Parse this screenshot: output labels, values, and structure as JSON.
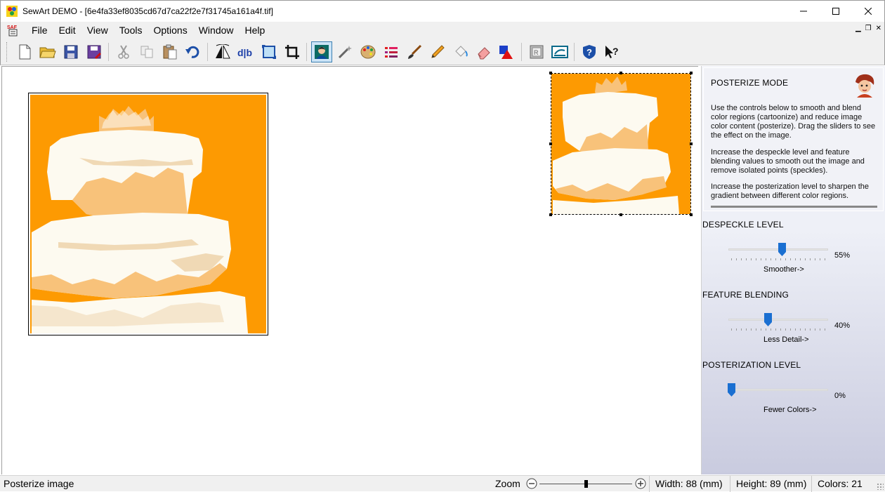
{
  "window": {
    "title": "SewArt DEMO - [6e4fa33ef8035cd67d7ca22f2e7f31745a161a4f.tif]"
  },
  "menu": {
    "items": [
      "File",
      "Edit",
      "View",
      "Tools",
      "Options",
      "Window",
      "Help"
    ]
  },
  "toolbar": {
    "icons": [
      "new-icon",
      "open-icon",
      "save-icon",
      "save-as-icon",
      "cut-icon",
      "copy-icon",
      "paste-icon",
      "undo-icon",
      "flip-icon",
      "mirror-icon",
      "resize-icon",
      "crop-icon",
      "posterize-icon",
      "magic-wand-icon",
      "palette-icon",
      "color-list-icon",
      "brush-icon",
      "pencil-icon",
      "fill-icon",
      "eraser-icon",
      "shapes-icon",
      "stitch-icon",
      "export-icon",
      "help-icon",
      "whats-this-icon"
    ],
    "active": "posterize-icon"
  },
  "panel": {
    "title": "POSTERIZE MODE",
    "paragraphs": [
      "Use the controls below to smooth and blend color regions (cartoonize) and reduce image color content (posterize). Drag the sliders to see the effect on the image.",
      "Increase the despeckle level and feature blending values to  smooth out the image and remove isolated points (speckles).",
      "Increase the posterization level to sharpen the gradient between different color regions."
    ],
    "sliders": [
      {
        "label": "DESPECKLE LEVEL",
        "value": 0.55,
        "value_text": "55%",
        "caption": "Smoother->"
      },
      {
        "label": "FEATURE BLENDING",
        "value": 0.4,
        "value_text": "40%",
        "caption": "Less Detail->"
      },
      {
        "label": "POSTERIZATION LEVEL",
        "value": 0.0,
        "value_text": "0%",
        "caption": "Fewer Colors->"
      }
    ],
    "accent": "#1a6fd1"
  },
  "status": {
    "message": "Posterize image",
    "zoom_label": "Zoom",
    "width": "Width: 88 (mm)",
    "height": "Height: 89 (mm)",
    "colors": "Colors: 21"
  },
  "image": {
    "background": "#fd9a02",
    "frosting": "#fdfaf0",
    "shade": "#f8c27a",
    "mid": "#f0d9b5"
  }
}
